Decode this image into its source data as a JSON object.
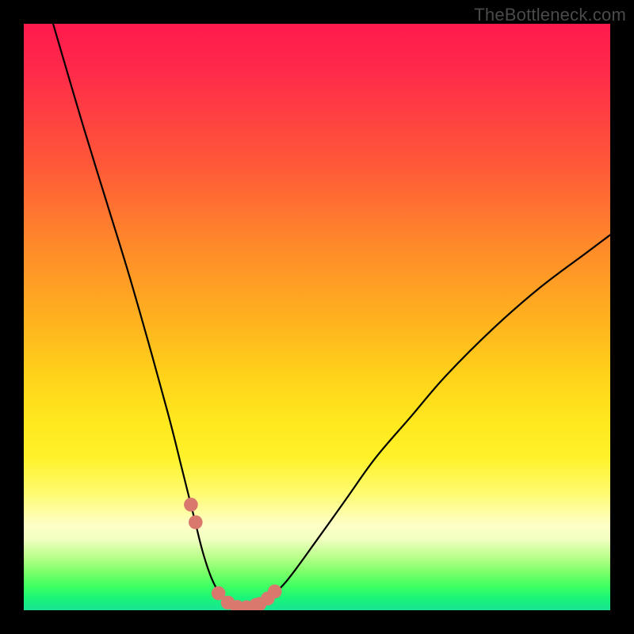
{
  "watermark": "TheBottleneck.com",
  "colors": {
    "frame": "#000000",
    "curve": "#000000",
    "marker": "#d9786d"
  },
  "chart_data": {
    "type": "line",
    "title": "",
    "xlabel": "",
    "ylabel": "",
    "xlim": [
      0,
      100
    ],
    "ylim": [
      0,
      100
    ],
    "grid": false,
    "legend": false,
    "series": [
      {
        "name": "bottleneck-curve",
        "x": [
          5,
          10,
          14,
          18,
          22,
          25,
          27,
          29,
          30.5,
          32,
          33.5,
          35,
          36.5,
          38,
          40,
          42,
          45,
          50,
          55,
          60,
          66,
          72,
          80,
          88,
          96,
          100
        ],
        "y": [
          100,
          83,
          70,
          57,
          43,
          32,
          24,
          16,
          10,
          5.5,
          2.7,
          1.2,
          0.5,
          0.5,
          1.0,
          2.3,
          5.2,
          12,
          19,
          26,
          33,
          40,
          48,
          55,
          61,
          64
        ]
      }
    ],
    "markers": {
      "name": "highlight-points",
      "x": [
        28.5,
        29.3,
        33.2,
        34.8,
        36.4,
        38.0,
        39.6,
        40.2,
        41.6,
        42.8
      ],
      "y": [
        18.0,
        15.0,
        2.9,
        1.3,
        0.55,
        0.5,
        0.9,
        1.05,
        2.0,
        3.2
      ]
    }
  }
}
